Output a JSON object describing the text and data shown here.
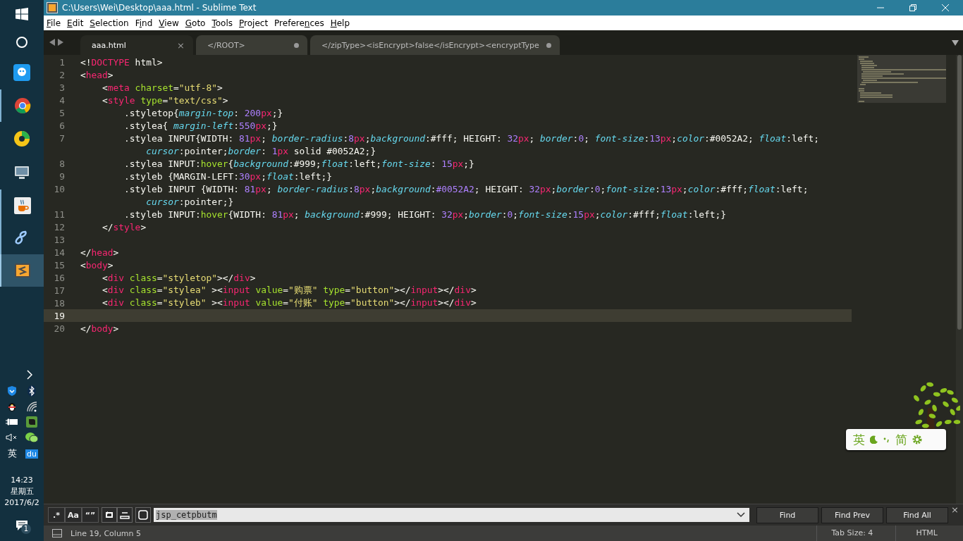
{
  "taskbar": {
    "ime": "英",
    "ime_app": "du",
    "time": "14:23",
    "weekday": "星期五",
    "date": "2017/6/2",
    "notifications": "1"
  },
  "window": {
    "title": "C:\\Users\\Wei\\Desktop\\aaa.html - Sublime Text"
  },
  "menu": [
    {
      "key": "F",
      "after": "ile"
    },
    {
      "key": "E",
      "after": "dit"
    },
    {
      "key": "S",
      "after": "election"
    },
    {
      "before": "F",
      "key": "i",
      "after": "nd"
    },
    {
      "key": "V",
      "after": "iew"
    },
    {
      "key": "G",
      "after": "oto"
    },
    {
      "key": "T",
      "after": "ools"
    },
    {
      "key": "P",
      "after": "roject"
    },
    {
      "before": "Prefere",
      "key": "n",
      "after": "ces"
    },
    {
      "key": "H",
      "after": "elp"
    }
  ],
  "tabs": [
    {
      "label": "aaa.html",
      "selected": true,
      "modified": false,
      "close": "×"
    },
    {
      "label": "</ROOT>",
      "selected": false,
      "modified": true
    },
    {
      "label": "</zipType><isEncrypt>false</isEncrypt><encryptType",
      "selected": false,
      "modified": true
    }
  ],
  "lines": [
    {
      "number": "1",
      "current": false,
      "rows": [
        {
          "tokens": [
            {
              "kind": "plain",
              "text": "<!"
            },
            {
              "kind": "tag",
              "text": "DOCTYPE"
            },
            {
              "kind": "plain",
              "text": " html>"
            }
          ]
        }
      ]
    },
    {
      "number": "2",
      "current": false,
      "rows": [
        {
          "tokens": [
            {
              "kind": "plain",
              "text": "<"
            },
            {
              "kind": "tag",
              "text": "head"
            },
            {
              "kind": "plain",
              "text": ">"
            }
          ]
        }
      ]
    },
    {
      "number": "3",
      "current": false,
      "rows": [
        {
          "tokens": [
            {
              "kind": "plain",
              "text": "    <"
            },
            {
              "kind": "tag",
              "text": "meta"
            },
            {
              "kind": "attr",
              "text": " charset"
            },
            {
              "kind": "plain",
              "text": "="
            },
            {
              "kind": "string",
              "text": "\"utf-8\""
            },
            {
              "kind": "plain",
              "text": ">"
            }
          ]
        }
      ]
    },
    {
      "number": "4",
      "current": false,
      "rows": [
        {
          "tokens": [
            {
              "kind": "plain",
              "text": "    <"
            },
            {
              "kind": "tag",
              "text": "style"
            },
            {
              "kind": "attr",
              "text": " type"
            },
            {
              "kind": "plain",
              "text": "="
            },
            {
              "kind": "string",
              "text": "\"text/css\""
            },
            {
              "kind": "plain",
              "text": ">"
            }
          ]
        }
      ]
    },
    {
      "number": "5",
      "current": false,
      "rows": [
        {
          "tokens": [
            {
              "kind": "plain",
              "text": "        .styletop{"
            },
            {
              "kind": "property",
              "text": "margin-top"
            },
            {
              "kind": "plain",
              "text": ": "
            },
            {
              "kind": "number",
              "text": "200"
            },
            {
              "kind": "unit",
              "text": "px"
            },
            {
              "kind": "plain",
              "text": ";}"
            }
          ]
        }
      ]
    },
    {
      "number": "6",
      "current": false,
      "rows": [
        {
          "tokens": [
            {
              "kind": "plain",
              "text": "        .stylea{ "
            },
            {
              "kind": "property",
              "text": "margin-left"
            },
            {
              "kind": "plain",
              "text": ":"
            },
            {
              "kind": "number",
              "text": "550"
            },
            {
              "kind": "unit",
              "text": "px"
            },
            {
              "kind": "plain",
              "text": ";}"
            }
          ]
        }
      ]
    },
    {
      "number": "7",
      "current": false,
      "rows": [
        {
          "tokens": [
            {
              "kind": "plain",
              "text": "        .stylea INPUT{WIDTH: "
            },
            {
              "kind": "number",
              "text": "81"
            },
            {
              "kind": "unit",
              "text": "px"
            },
            {
              "kind": "plain",
              "text": "; "
            },
            {
              "kind": "property",
              "text": "border-radius"
            },
            {
              "kind": "plain",
              "text": ":"
            },
            {
              "kind": "number",
              "text": "8"
            },
            {
              "kind": "unit",
              "text": "px"
            },
            {
              "kind": "plain",
              "text": ";"
            },
            {
              "kind": "property",
              "text": "background"
            },
            {
              "kind": "plain",
              "text": ":#fff; HEIGHT: "
            },
            {
              "kind": "number",
              "text": "32"
            },
            {
              "kind": "unit",
              "text": "px"
            },
            {
              "kind": "plain",
              "text": "; "
            },
            {
              "kind": "property",
              "text": "border"
            },
            {
              "kind": "plain",
              "text": ":"
            },
            {
              "kind": "number",
              "text": "0"
            },
            {
              "kind": "plain",
              "text": "; "
            },
            {
              "kind": "property",
              "text": "font-size"
            },
            {
              "kind": "plain",
              "text": ":"
            },
            {
              "kind": "number",
              "text": "13"
            },
            {
              "kind": "unit",
              "text": "px"
            },
            {
              "kind": "plain",
              "text": ";"
            },
            {
              "kind": "property",
              "text": "color"
            },
            {
              "kind": "plain",
              "text": ":#0052A2; "
            },
            {
              "kind": "property",
              "text": "float"
            },
            {
              "kind": "plain",
              "text": ":left;"
            }
          ]
        },
        {
          "tokens": [
            {
              "kind": "property",
              "text": "            cursor"
            },
            {
              "kind": "plain",
              "text": ":pointer;"
            },
            {
              "kind": "property",
              "text": "border"
            },
            {
              "kind": "plain",
              "text": ": "
            },
            {
              "kind": "number",
              "text": "1"
            },
            {
              "kind": "unit",
              "text": "px"
            },
            {
              "kind": "plain",
              "text": " solid #0052A2;}"
            }
          ]
        }
      ]
    },
    {
      "number": "8",
      "current": false,
      "rows": [
        {
          "tokens": [
            {
              "kind": "plain",
              "text": "        .stylea INPUT:"
            },
            {
              "kind": "pseudo",
              "text": "hover"
            },
            {
              "kind": "plain",
              "text": "{"
            },
            {
              "kind": "property",
              "text": "background"
            },
            {
              "kind": "plain",
              "text": ":#999;"
            },
            {
              "kind": "property",
              "text": "float"
            },
            {
              "kind": "plain",
              "text": ":left;"
            },
            {
              "kind": "property",
              "text": "font-size"
            },
            {
              "kind": "plain",
              "text": ": "
            },
            {
              "kind": "number",
              "text": "15"
            },
            {
              "kind": "unit",
              "text": "px"
            },
            {
              "kind": "plain",
              "text": ";}"
            }
          ]
        }
      ]
    },
    {
      "number": "9",
      "current": false,
      "rows": [
        {
          "tokens": [
            {
              "kind": "plain",
              "text": "        .styleb {MARGIN-LEFT:"
            },
            {
              "kind": "number",
              "text": "30"
            },
            {
              "kind": "unit",
              "text": "px"
            },
            {
              "kind": "plain",
              "text": ";"
            },
            {
              "kind": "property",
              "text": "float"
            },
            {
              "kind": "plain",
              "text": ":left;}"
            }
          ]
        }
      ]
    },
    {
      "number": "10",
      "current": false,
      "rows": [
        {
          "tokens": [
            {
              "kind": "plain",
              "text": "        .styleb INPUT {WIDTH: "
            },
            {
              "kind": "number",
              "text": "81"
            },
            {
              "kind": "unit",
              "text": "px"
            },
            {
              "kind": "plain",
              "text": "; "
            },
            {
              "kind": "property",
              "text": "border-radius"
            },
            {
              "kind": "plain",
              "text": ":"
            },
            {
              "kind": "number",
              "text": "8"
            },
            {
              "kind": "unit",
              "text": "px"
            },
            {
              "kind": "plain",
              "text": ";"
            },
            {
              "kind": "property",
              "text": "background"
            },
            {
              "kind": "plain",
              "text": ":"
            },
            {
              "kind": "number",
              "text": "#0052A2"
            },
            {
              "kind": "plain",
              "text": "; HEIGHT: "
            },
            {
              "kind": "number",
              "text": "32"
            },
            {
              "kind": "unit",
              "text": "px"
            },
            {
              "kind": "plain",
              "text": ";"
            },
            {
              "kind": "property",
              "text": "border"
            },
            {
              "kind": "plain",
              "text": ":"
            },
            {
              "kind": "number",
              "text": "0"
            },
            {
              "kind": "plain",
              "text": ";"
            },
            {
              "kind": "property",
              "text": "font-size"
            },
            {
              "kind": "plain",
              "text": ":"
            },
            {
              "kind": "number",
              "text": "13"
            },
            {
              "kind": "unit",
              "text": "px"
            },
            {
              "kind": "plain",
              "text": ";"
            },
            {
              "kind": "property",
              "text": "color"
            },
            {
              "kind": "plain",
              "text": ":#fff;"
            },
            {
              "kind": "property",
              "text": "float"
            },
            {
              "kind": "plain",
              "text": ":left;"
            }
          ]
        },
        {
          "tokens": [
            {
              "kind": "property",
              "text": "            cursor"
            },
            {
              "kind": "plain",
              "text": ":pointer;}"
            }
          ]
        }
      ]
    },
    {
      "number": "11",
      "current": false,
      "rows": [
        {
          "tokens": [
            {
              "kind": "plain",
              "text": "        .styleb INPUT:"
            },
            {
              "kind": "pseudo",
              "text": "hover"
            },
            {
              "kind": "plain",
              "text": "{WIDTH: "
            },
            {
              "kind": "number",
              "text": "81"
            },
            {
              "kind": "unit",
              "text": "px"
            },
            {
              "kind": "plain",
              "text": "; "
            },
            {
              "kind": "property",
              "text": "background"
            },
            {
              "kind": "plain",
              "text": ":#999; HEIGHT: "
            },
            {
              "kind": "number",
              "text": "32"
            },
            {
              "kind": "unit",
              "text": "px"
            },
            {
              "kind": "plain",
              "text": ";"
            },
            {
              "kind": "property",
              "text": "border"
            },
            {
              "kind": "plain",
              "text": ":"
            },
            {
              "kind": "number",
              "text": "0"
            },
            {
              "kind": "plain",
              "text": ";"
            },
            {
              "kind": "property",
              "text": "font-size"
            },
            {
              "kind": "plain",
              "text": ":"
            },
            {
              "kind": "number",
              "text": "15"
            },
            {
              "kind": "unit",
              "text": "px"
            },
            {
              "kind": "plain",
              "text": ";"
            },
            {
              "kind": "property",
              "text": "color"
            },
            {
              "kind": "plain",
              "text": ":#fff;"
            },
            {
              "kind": "property",
              "text": "float"
            },
            {
              "kind": "plain",
              "text": ":left;}"
            }
          ]
        }
      ]
    },
    {
      "number": "12",
      "current": false,
      "rows": [
        {
          "tokens": [
            {
              "kind": "plain",
              "text": "    </"
            },
            {
              "kind": "tag",
              "text": "style"
            },
            {
              "kind": "plain",
              "text": ">"
            }
          ]
        }
      ]
    },
    {
      "number": "13",
      "current": false
    },
    {
      "number": "14",
      "current": false,
      "rows": [
        {
          "tokens": [
            {
              "kind": "plain",
              "text": "</"
            },
            {
              "kind": "tag",
              "text": "head"
            },
            {
              "kind": "plain",
              "text": ">"
            }
          ]
        }
      ]
    },
    {
      "number": "15",
      "current": false,
      "rows": [
        {
          "tokens": [
            {
              "kind": "plain",
              "text": "<"
            },
            {
              "kind": "tag",
              "text": "body"
            },
            {
              "kind": "plain",
              "text": ">"
            }
          ]
        }
      ]
    },
    {
      "number": "16",
      "current": false,
      "rows": [
        {
          "tokens": [
            {
              "kind": "plain",
              "text": "    <"
            },
            {
              "kind": "tag",
              "text": "div"
            },
            {
              "kind": "attr",
              "text": " class"
            },
            {
              "kind": "plain",
              "text": "="
            },
            {
              "kind": "string",
              "text": "\"styletop\""
            },
            {
              "kind": "plain",
              "text": "></"
            },
            {
              "kind": "tag",
              "text": "div"
            },
            {
              "kind": "plain",
              "text": ">"
            }
          ]
        }
      ]
    },
    {
      "number": "17",
      "current": false,
      "rows": [
        {
          "tokens": [
            {
              "kind": "plain",
              "text": "    <"
            },
            {
              "kind": "tag",
              "text": "div"
            },
            {
              "kind": "attr",
              "text": " class"
            },
            {
              "kind": "plain",
              "text": "="
            },
            {
              "kind": "string",
              "text": "\"stylea\""
            },
            {
              "kind": "plain",
              "text": " ><"
            },
            {
              "kind": "tag",
              "text": "input"
            },
            {
              "kind": "attr",
              "text": " value"
            },
            {
              "kind": "plain",
              "text": "="
            },
            {
              "kind": "string",
              "text": "\"购票\""
            },
            {
              "kind": "attr",
              "text": " type"
            },
            {
              "kind": "plain",
              "text": "="
            },
            {
              "kind": "string",
              "text": "\"button\""
            },
            {
              "kind": "plain",
              "text": "></"
            },
            {
              "kind": "tag",
              "text": "input"
            },
            {
              "kind": "plain",
              "text": "></"
            },
            {
              "kind": "tag",
              "text": "div"
            },
            {
              "kind": "plain",
              "text": ">"
            }
          ]
        }
      ]
    },
    {
      "number": "18",
      "current": false,
      "rows": [
        {
          "tokens": [
            {
              "kind": "plain",
              "text": "    <"
            },
            {
              "kind": "tag",
              "text": "div"
            },
            {
              "kind": "attr",
              "text": " class"
            },
            {
              "kind": "plain",
              "text": "="
            },
            {
              "kind": "string",
              "text": "\"styleb\""
            },
            {
              "kind": "plain",
              "text": " ><"
            },
            {
              "kind": "tag",
              "text": "input"
            },
            {
              "kind": "attr",
              "text": " value"
            },
            {
              "kind": "plain",
              "text": "="
            },
            {
              "kind": "string",
              "text": "\"付账\""
            },
            {
              "kind": "attr",
              "text": " type"
            },
            {
              "kind": "plain",
              "text": "="
            },
            {
              "kind": "string",
              "text": "\"button\""
            },
            {
              "kind": "plain",
              "text": "></"
            },
            {
              "kind": "tag",
              "text": "input"
            },
            {
              "kind": "plain",
              "text": "></"
            },
            {
              "kind": "tag",
              "text": "div"
            },
            {
              "kind": "plain",
              "text": ">"
            }
          ]
        }
      ]
    },
    {
      "number": "19",
      "current": true
    },
    {
      "number": "20",
      "current": false,
      "rows": [
        {
          "tokens": [
            {
              "kind": "plain",
              "text": "</"
            },
            {
              "kind": "tag",
              "text": "body"
            },
            {
              "kind": "plain",
              "text": ">"
            }
          ]
        }
      ]
    }
  ],
  "ime_widget": {
    "mode": "英",
    "script": "简"
  },
  "find_bar": {
    "options": [
      ".*",
      "Aa",
      "“”"
    ],
    "value": "jsp_cetpbutm",
    "buttons": [
      "Find",
      "Find Prev",
      "Find All"
    ],
    "close": "×"
  },
  "status_bar": {
    "position": "Line 19, Column 5",
    "tab_size": "Tab Size: 4",
    "syntax": "HTML"
  }
}
